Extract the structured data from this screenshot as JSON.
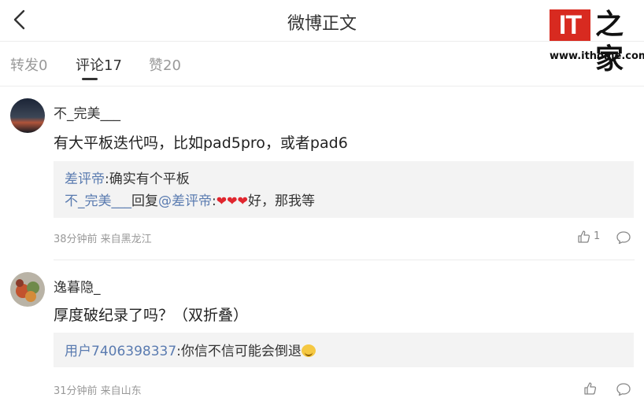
{
  "header": {
    "title": "微博正文"
  },
  "logo": {
    "brand": "IT之家",
    "mark": "IT",
    "url": "www.ithome.com"
  },
  "tabs": [
    {
      "label": "转发0",
      "active": false
    },
    {
      "label": "评论17",
      "active": true
    },
    {
      "label": "赞20",
      "active": false
    }
  ],
  "comments": [
    {
      "author": "不_完美___",
      "text": "有大平板迭代吗，比如pad5pro，或者pad6",
      "replies": [
        {
          "from": "差评帝",
          "text": ":确实有个平板"
        },
        {
          "from": "不_完美___",
          "action": "回复",
          "to": "@差评帝",
          "colon": ":",
          "hearts": "❤❤❤",
          "tail": "好，那我等"
        }
      ],
      "meta": "38分钟前 来自黑龙江",
      "likes": "1"
    },
    {
      "author": "逸暮隐_",
      "text": "厚度破纪录了吗？（双折叠）",
      "replies": [
        {
          "from": "用户7406398337",
          "text": ":你信不信可能会倒退",
          "emoji": "laughing-face"
        }
      ],
      "meta": "31分钟前 来自山东",
      "likes": ""
    }
  ],
  "colors": {
    "link": "#5a7bb0",
    "heart": "#e0262e",
    "brand_red": "#d82a20"
  }
}
